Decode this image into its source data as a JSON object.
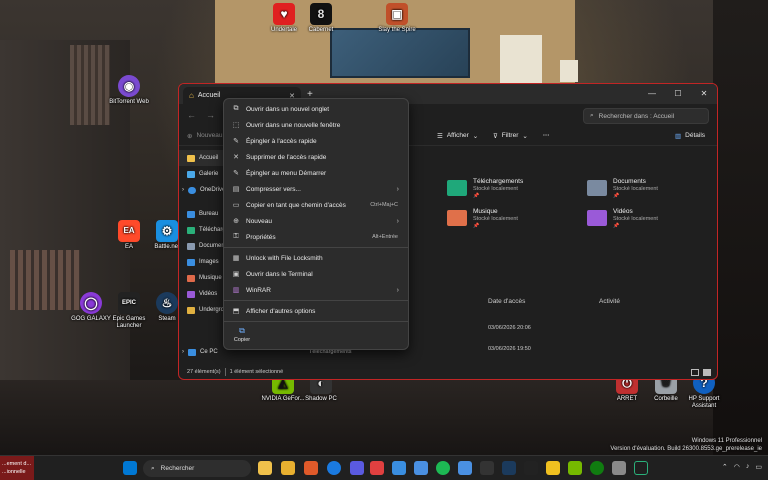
{
  "desktop_icons": [
    {
      "label": "Undertale",
      "color": "#e02020",
      "glyph": "♥"
    },
    {
      "label": "Cabernet",
      "color": "#111111",
      "glyph": "8"
    },
    {
      "label": "Slay the Spire",
      "color": "#c0502a",
      "glyph": "▣"
    },
    {
      "label": "BitTorrent Web",
      "color": "#7a4ad0",
      "glyph": "◉"
    },
    {
      "label": "EA",
      "color": "#ff4a2a",
      "glyph": "EA"
    },
    {
      "label": "Battle.net",
      "color": "#1a8fe0",
      "glyph": "⚙"
    },
    {
      "label": "GOG GALAXY",
      "color": "#8a3ad8",
      "glyph": "◯"
    },
    {
      "label": "Epic Games Launcher",
      "color": "#222222",
      "glyph": "EPIC"
    },
    {
      "label": "Steam",
      "color": "#1b3a5c",
      "glyph": "♨"
    },
    {
      "label": "NVIDIA GeFor...",
      "color": "#76b900",
      "glyph": "◭"
    },
    {
      "label": "Shadow PC",
      "color": "#333333",
      "glyph": "◐"
    },
    {
      "label": "ARRET",
      "color": "#c03030",
      "glyph": "⏻"
    },
    {
      "label": "Corbeille",
      "color": "#9aa0a6",
      "glyph": "🗑"
    },
    {
      "label": "HP Support Assistant",
      "color": "#1060c0",
      "glyph": "?"
    }
  ],
  "window": {
    "tab_label": "Accueil",
    "new_tab": "+",
    "search_placeholder": "Rechercher dans : Accueil",
    "toolbar": {
      "new_label": "Nouveau",
      "view_label": "Afficher",
      "filter_label": "Filtrer",
      "more_label": "···",
      "details_label": "Détails"
    },
    "sidebar": [
      {
        "label": "Accueil",
        "color": "#f0c14b"
      },
      {
        "label": "Galerie",
        "color": "#4aa8e8"
      },
      {
        "label": "OneDrive",
        "color": "#3a8ee0"
      },
      {
        "label": "Bureau",
        "color": "#3a8ee0"
      },
      {
        "label": "Téléchargements",
        "color": "#2ab07a"
      },
      {
        "label": "Documents",
        "color": "#8a9ab0"
      },
      {
        "label": "Images",
        "color": "#3a8ee0"
      },
      {
        "label": "Musique",
        "color": "#e06a4a"
      },
      {
        "label": "Vidéos",
        "color": "#9a5ad8"
      },
      {
        "label": "Underground",
        "color": "#e0b040"
      },
      {
        "label": "Ce PC",
        "color": "#3a8ee0"
      }
    ],
    "quick_access": [
      {
        "name": "Téléchargements",
        "sub": "Stocké localement",
        "color": "#1fa87a"
      },
      {
        "name": "Documents",
        "sub": "Stocké localement",
        "color": "#7a8aa0"
      },
      {
        "name": "Musique",
        "sub": "Stocké localement",
        "color": "#e0704a"
      },
      {
        "name": "Vidéos",
        "sub": "Stocké localement",
        "color": "#9a5ad8"
      }
    ],
    "columns": {
      "date": "Date d'accès",
      "activity": "Activité"
    },
    "rows": [
      {
        "name": "",
        "date": "03/06/2026 20:06"
      },
      {
        "name": "Téléchargements",
        "date": "03/06/2026 19:50"
      }
    ],
    "status": {
      "count": "27 élément(s)",
      "selected": "1 élément sélectionné"
    }
  },
  "context_menu": {
    "items": [
      {
        "label": "Ouvrir dans un nouvel onglet",
        "icon": "new-tab-icon",
        "glyph": "⧉"
      },
      {
        "label": "Ouvrir dans une nouvelle fenêtre",
        "icon": "new-window-icon",
        "glyph": "⬚"
      },
      {
        "label": "Épingler à l'accès rapide",
        "icon": "pin-icon",
        "glyph": "✎"
      },
      {
        "label": "Supprimer de l'accès rapide",
        "icon": "unpin-icon",
        "glyph": "✕"
      },
      {
        "label": "Épingler au menu Démarrer",
        "icon": "pin-start-icon",
        "glyph": "✎"
      },
      {
        "label": "Compresser vers...",
        "icon": "compress-icon",
        "glyph": "▤",
        "submenu": true
      },
      {
        "label": "Copier en tant que chemin d'accès",
        "icon": "copy-path-icon",
        "glyph": "▭",
        "shortcut": "Ctrl+Maj+C"
      },
      {
        "label": "Nouveau",
        "icon": "new-icon",
        "glyph": "⊕",
        "submenu": true
      },
      {
        "label": "Propriétés",
        "icon": "properties-icon",
        "glyph": "⚿",
        "shortcut": "Alt+Entrée"
      },
      {
        "label": "Unlock with File Locksmith",
        "icon": "lock-icon",
        "glyph": "▦"
      },
      {
        "label": "Ouvrir dans le Terminal",
        "icon": "terminal-icon",
        "glyph": "▣"
      },
      {
        "label": "WinRAR",
        "icon": "winrar-icon",
        "glyph": "▥",
        "submenu": true
      },
      {
        "label": "Afficher d'autres options",
        "icon": "more-options-icon",
        "glyph": "⬒"
      }
    ],
    "copy_label": "Copier"
  },
  "taskbar": {
    "notification": "...ement d... ...ionnelle",
    "search_placeholder": "Rechercher",
    "apps": [
      "#0078d4",
      "#f0c14b",
      "#e05a2a",
      "#1a7ae0",
      "#5a5ae0",
      "#e04040",
      "#3a8ee0",
      "#1db954",
      "#4a90e2",
      "#222222",
      "#ffffff",
      "#f0c020",
      "#76b900",
      "#107c10",
      "#8a8a8a",
      "#1f1f1f"
    ]
  },
  "watermark": {
    "line1": "Windows 11 Professionnel",
    "line2": "Version d'évaluation. Build 26300.8553.ge_prerelease_ie"
  }
}
